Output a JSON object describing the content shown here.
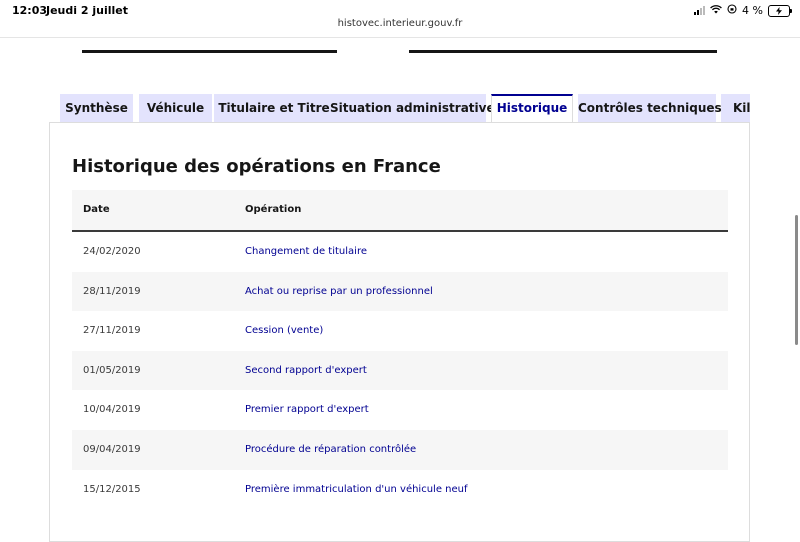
{
  "status_bar": {
    "time": "12:03",
    "date": "Jeudi 2 juillet",
    "battery": "4 %",
    "url": "histovec.interieur.gouv.fr"
  },
  "tabs": [
    {
      "label": "Synthèse"
    },
    {
      "label": "Véhicule"
    },
    {
      "label": "Titulaire et Titre"
    },
    {
      "label": "Situation administrative"
    },
    {
      "label": "Historique"
    },
    {
      "label": "Contrôles techniques"
    },
    {
      "label": "Kilométrage"
    }
  ],
  "active_tab": "Historique",
  "section": {
    "title": "Historique des opérations en France"
  },
  "table": {
    "headers": {
      "date": "Date",
      "operation": "Opération"
    },
    "rows": [
      {
        "date": "24/02/2020",
        "operation": "Changement de titulaire"
      },
      {
        "date": "28/11/2019",
        "operation": "Achat ou reprise par un professionnel"
      },
      {
        "date": "27/11/2019",
        "operation": "Cession (vente)"
      },
      {
        "date": "01/05/2019",
        "operation": "Second rapport d'expert"
      },
      {
        "date": "10/04/2019",
        "operation": "Premier rapport d'expert"
      },
      {
        "date": "09/04/2019",
        "operation": "Procédure de réparation contrôlée"
      },
      {
        "date": "15/12/2015",
        "operation": "Première immatriculation d'un véhicule neuf"
      }
    ]
  },
  "colors": {
    "accent": "#000091",
    "tab_bg": "#e3e3fd",
    "row_alt": "#f6f6f6"
  }
}
